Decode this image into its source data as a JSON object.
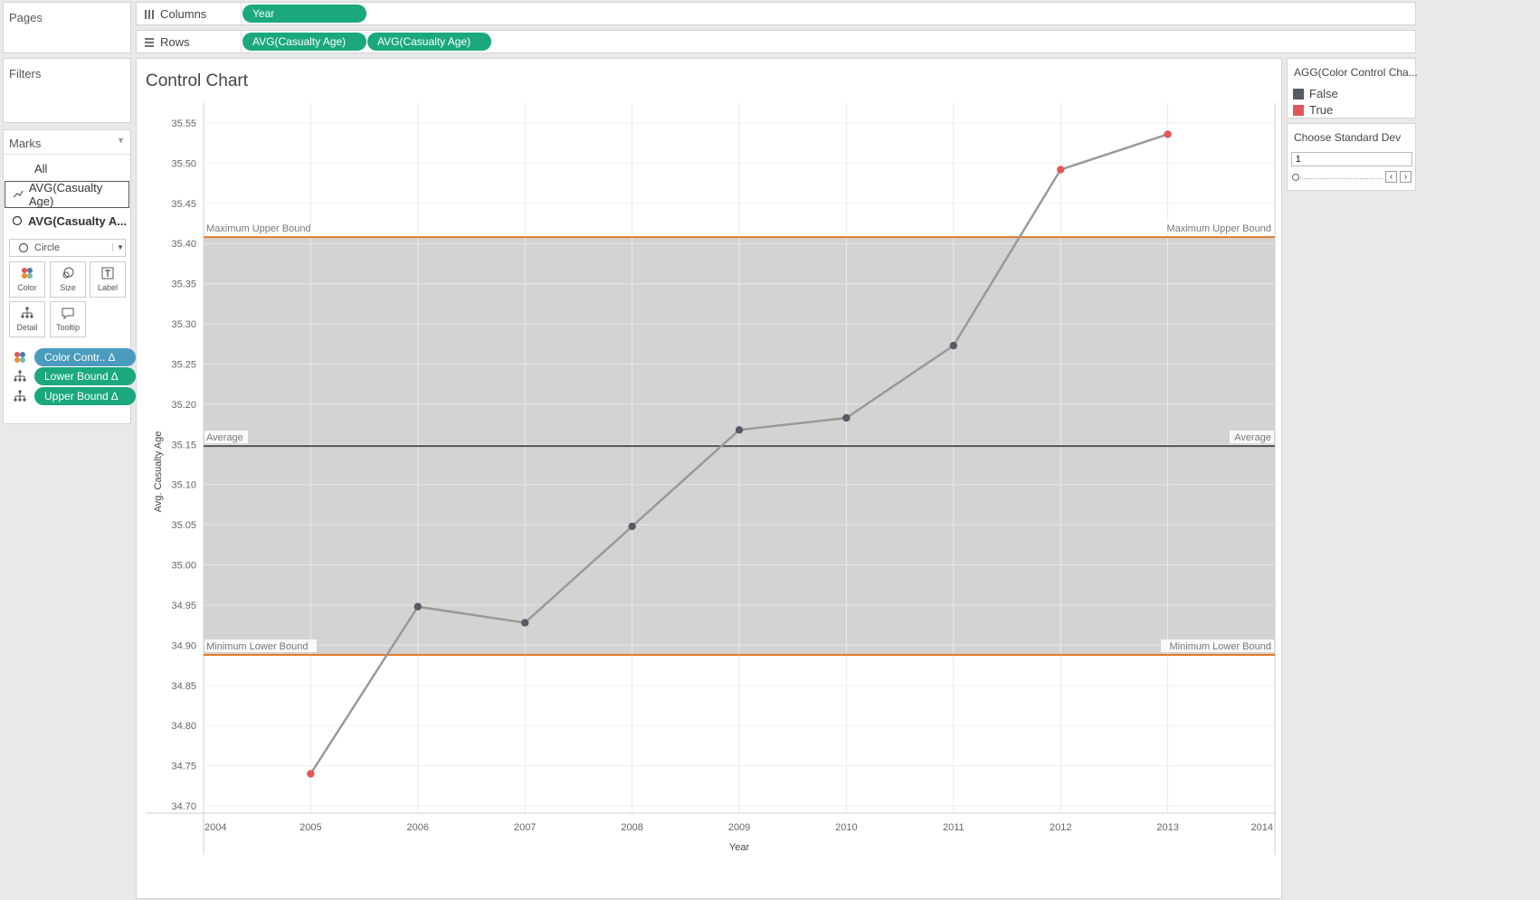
{
  "shelves": {
    "pages_label": "Pages",
    "filters_label": "Filters",
    "columns_label": "Columns",
    "rows_label": "Rows",
    "columns_pills": [
      "Year"
    ],
    "rows_pills": [
      "AVG(Casualty Age)",
      "AVG(Casualty Age)"
    ]
  },
  "marks": {
    "title": "Marks",
    "all_label": "All",
    "layer1_label": "AVG(Casualty Age)",
    "layer2_label": "AVG(Casualty A...",
    "mark_type": "Circle",
    "buttons": [
      "Color",
      "Size",
      "Label",
      "Detail",
      "Tooltip"
    ],
    "fields": [
      {
        "label": "Color Contr..  ∆",
        "icon": "color-icon",
        "color": "#4a9bbd"
      },
      {
        "label": "Lower Bound ∆",
        "icon": "detail-icon",
        "color": "#1ba87e"
      },
      {
        "label": "Upper Bound ∆",
        "icon": "detail-icon",
        "color": "#1ba87e"
      }
    ]
  },
  "legend": {
    "title": "AGG(Color Control Cha...",
    "items": [
      {
        "label": "False",
        "color": "#555c66"
      },
      {
        "label": "True",
        "color": "#e15759"
      }
    ]
  },
  "parameter": {
    "title": "Choose Standard Dev",
    "value": "1"
  },
  "chart_data": {
    "type": "line",
    "title": "Control Chart",
    "xlabel": "Year",
    "ylabel": "Avg. Casualty Age",
    "xlim": [
      2004,
      2014
    ],
    "ylim": [
      34.7,
      35.55
    ],
    "x_ticks": [
      2004,
      2005,
      2006,
      2007,
      2008,
      2009,
      2010,
      2011,
      2012,
      2013,
      2014
    ],
    "y_ticks": [
      35.55,
      35.5,
      35.45,
      35.4,
      35.35,
      35.3,
      35.25,
      35.2,
      35.15,
      35.1,
      35.05,
      35.0,
      34.95,
      34.9,
      34.85,
      34.8,
      34.75,
      34.7
    ],
    "x": [
      2005,
      2006,
      2007,
      2008,
      2009,
      2010,
      2011,
      2012,
      2013
    ],
    "y": [
      34.74,
      34.948,
      34.928,
      35.048,
      35.168,
      35.183,
      35.273,
      35.492,
      35.536
    ],
    "out_of_control": [
      true,
      false,
      false,
      false,
      false,
      false,
      false,
      true,
      true
    ],
    "reference_lines": [
      {
        "label": "Maximum Upper Bound",
        "value": 35.408,
        "color": "#e07b2a"
      },
      {
        "label": "Average",
        "value": 35.148,
        "color": "#555555"
      },
      {
        "label": "Minimum Lower Bound",
        "value": 34.888,
        "color": "#e07b2a"
      }
    ],
    "band_color": "#d3d3d3",
    "line_color": "#999999",
    "point_colors": {
      "false": "#555c66",
      "true": "#e15759"
    },
    "grid": true
  }
}
